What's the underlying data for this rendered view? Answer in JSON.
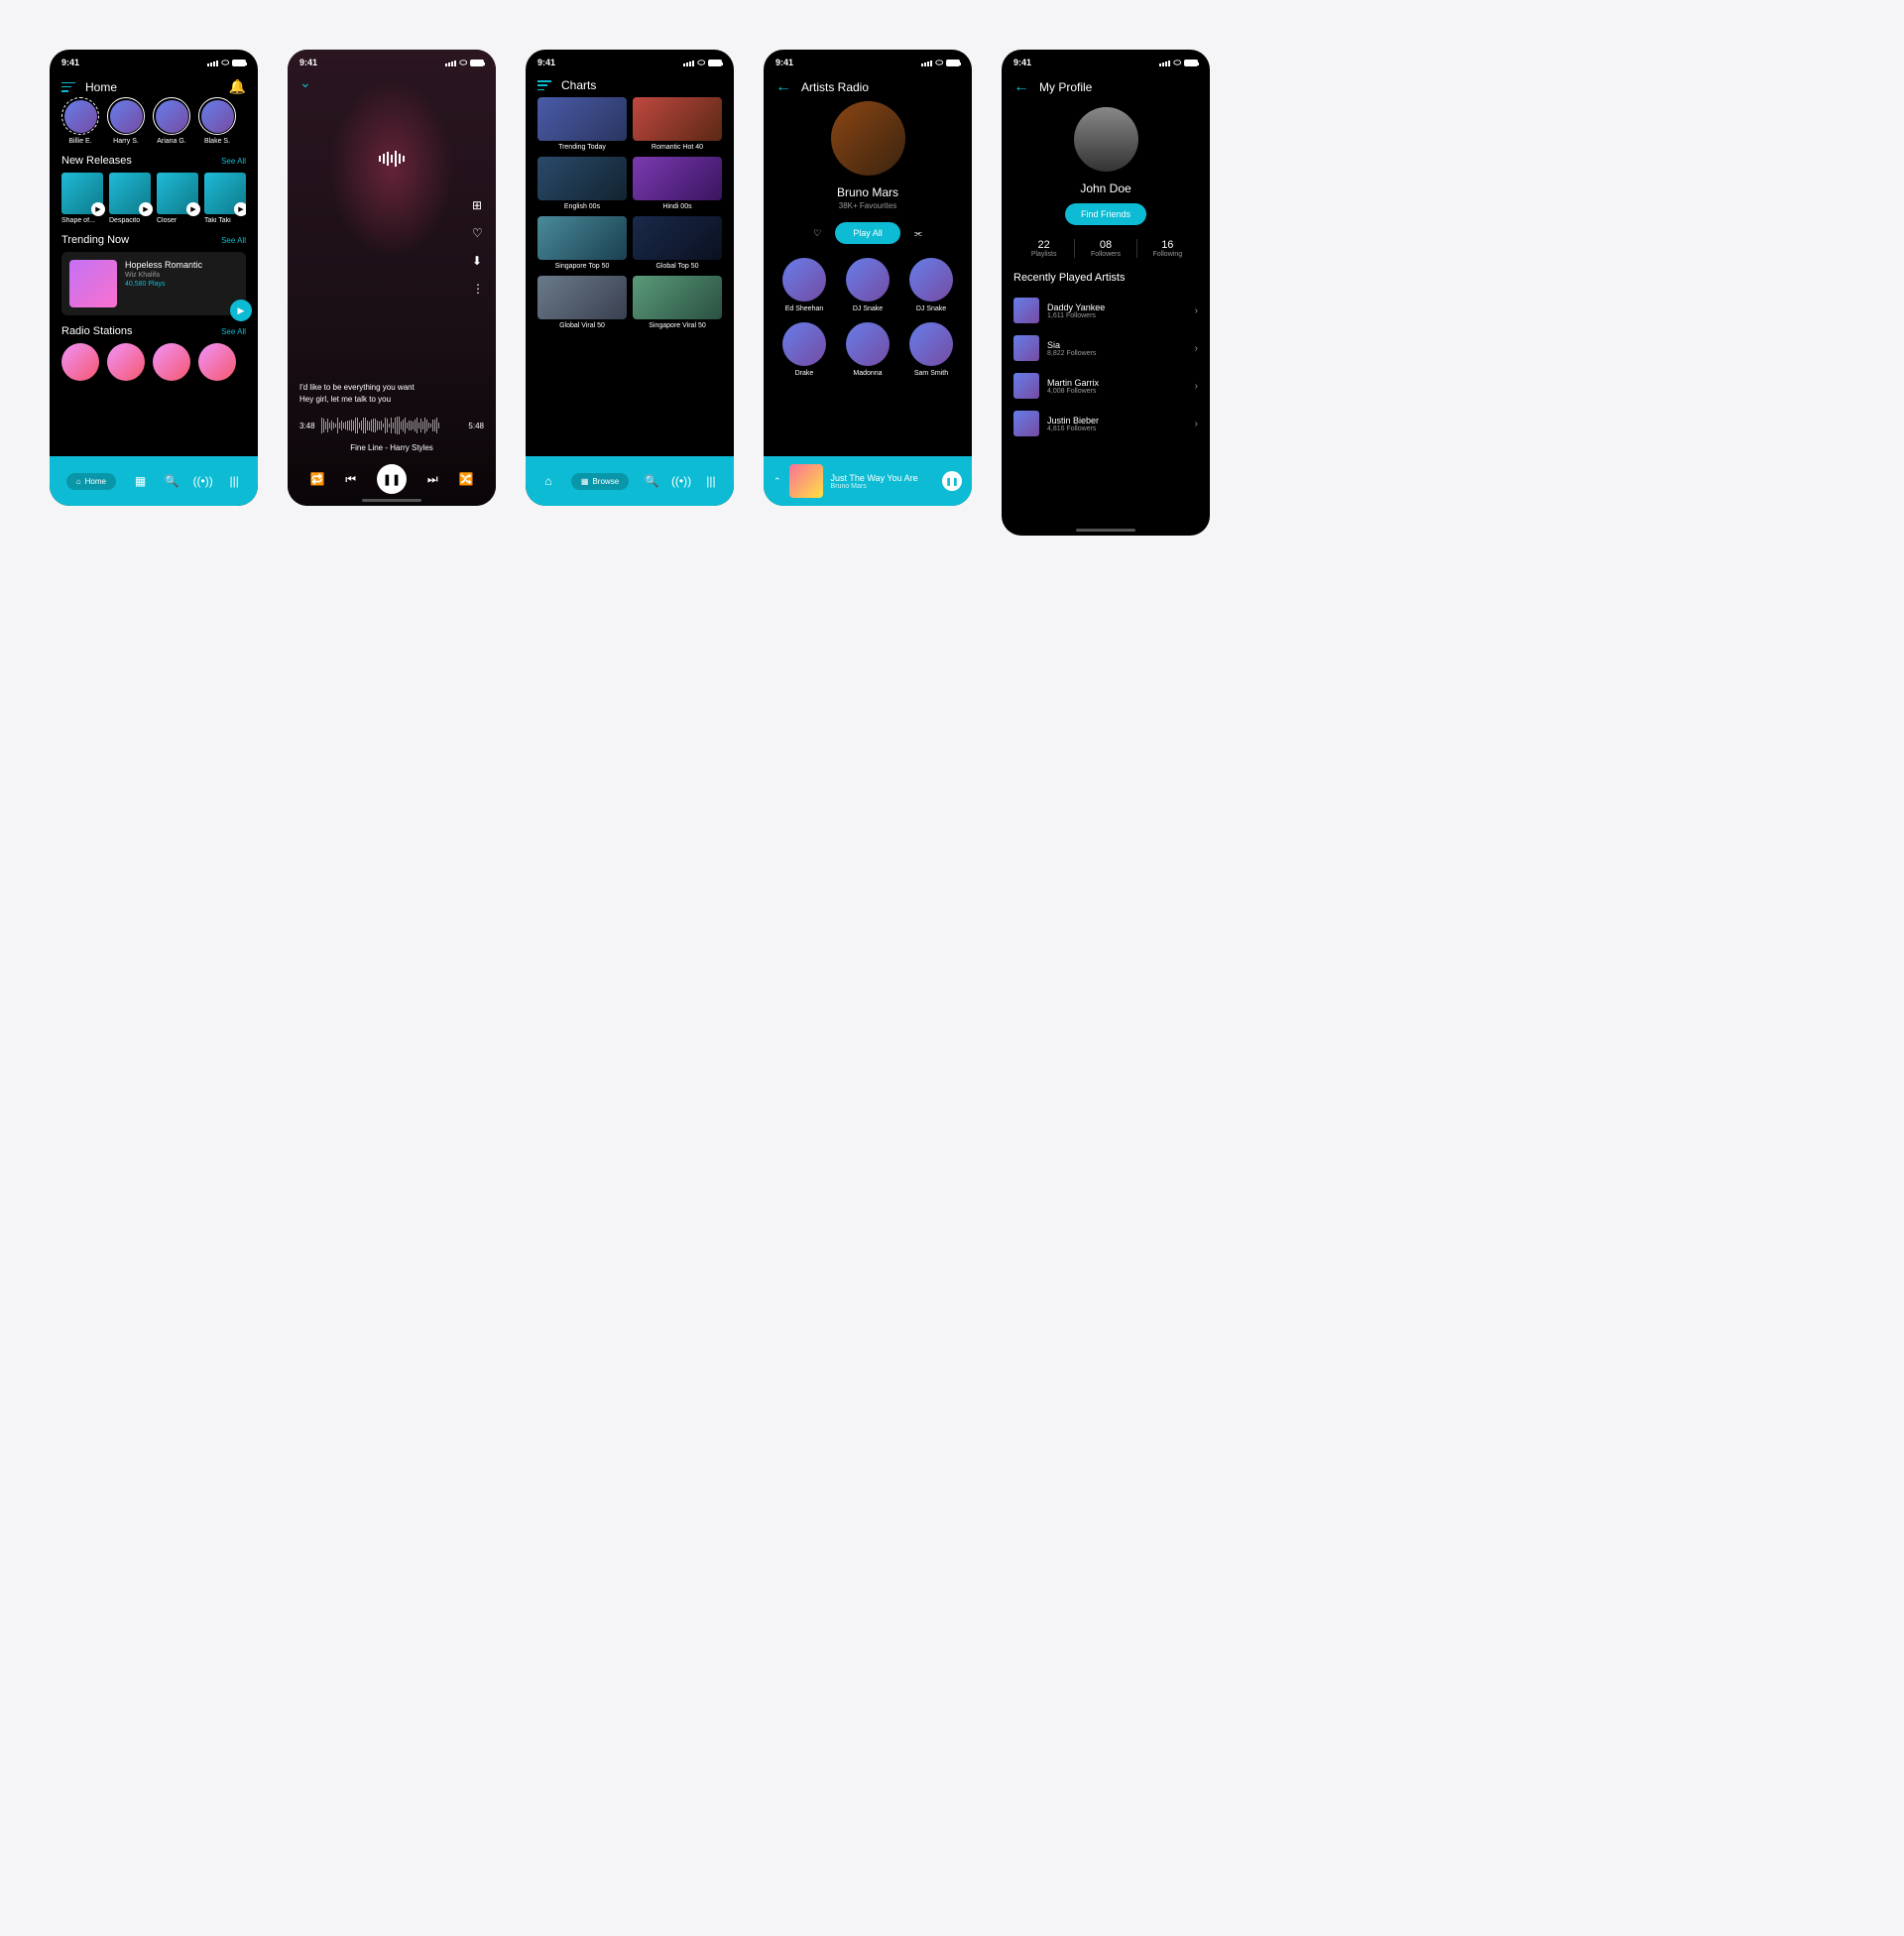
{
  "status_time": "9:41",
  "screen_home": {
    "title": "Home",
    "stories": [
      {
        "name": "Billie E.",
        "dashed": true
      },
      {
        "name": "Harry S."
      },
      {
        "name": "Ariana G."
      },
      {
        "name": "Blake S."
      }
    ],
    "new_releases": {
      "title": "New Releases",
      "see_all": "See All",
      "albums": [
        {
          "name": "Shape of..."
        },
        {
          "name": "Despacito"
        },
        {
          "name": "Closer"
        },
        {
          "name": "Taki Taki"
        }
      ]
    },
    "trending": {
      "title": "Trending Now",
      "see_all": "See All",
      "card": {
        "title": "Hopeless Romantic",
        "artist": "Wiz Khalifa",
        "plays": "40,580 Plays"
      }
    },
    "radio": {
      "title": "Radio Stations",
      "see_all": "See All"
    },
    "nav_active": "Home"
  },
  "screen_player": {
    "lyric1": "I'd like to be everything you want",
    "lyric2": "Hey girl, let me talk to you",
    "t_elapsed": "3:48",
    "t_total": "5:48",
    "track": "Fine Line - Harry Styles"
  },
  "screen_charts": {
    "title": "Charts",
    "tiles": [
      "Trending Today",
      "Romantic Hot 40",
      "English 00s",
      "Hindi 00s",
      "Singapore Top 50",
      "Global Top 50",
      "Global Viral 50",
      "Singapore Viral 50"
    ],
    "nav_active": "Browse"
  },
  "screen_artist": {
    "title": "Artists Radio",
    "name": "Bruno Mars",
    "favs": "38K+ Favourites",
    "play_all": "Play All",
    "related": [
      "Ed Sheehan",
      "DJ Snake",
      "DJ Snake",
      "Drake",
      "Madonna",
      "Sam Smith"
    ],
    "now_playing": {
      "title": "Just The Way You Are",
      "artist": "Bruno Mars"
    }
  },
  "screen_profile": {
    "title": "My Profile",
    "name": "John Doe",
    "find_friends": "Find Friends",
    "stats": [
      {
        "n": "22",
        "l": "Playlists"
      },
      {
        "n": "08",
        "l": "Followers"
      },
      {
        "n": "16",
        "l": "Following"
      }
    ],
    "recent_title": "Recently Played Artists",
    "recent": [
      {
        "name": "Daddy Yankee",
        "followers": "1,611 Followers"
      },
      {
        "name": "Sia",
        "followers": "8,822 Followers"
      },
      {
        "name": "Martin Garrix",
        "followers": "4,008 Followers"
      },
      {
        "name": "Justin Bieber",
        "followers": "4,816 Followers"
      }
    ]
  }
}
